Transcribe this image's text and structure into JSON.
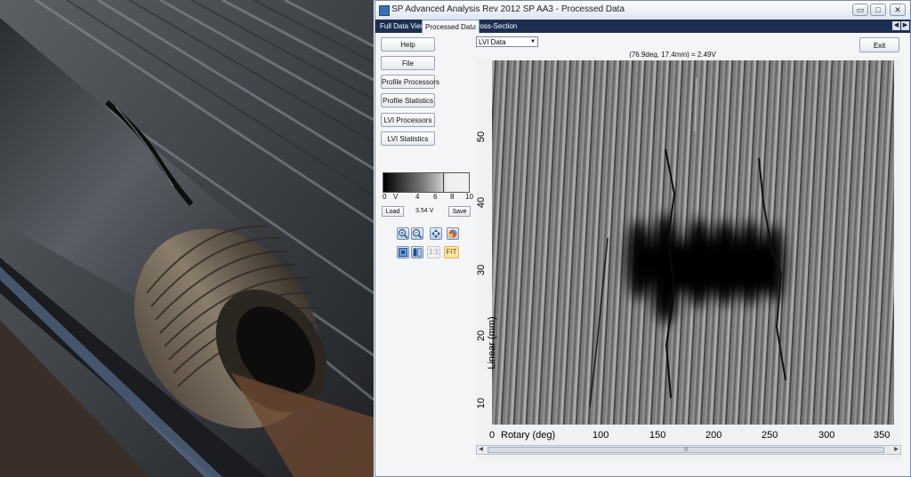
{
  "window": {
    "title": "SP Advanced Analysis Rev 2012 SP AA3 - Processed Data",
    "controls": {
      "minimize": "▭",
      "maximize": "□",
      "close": "✕"
    }
  },
  "tabs": [
    "Full Data View",
    "Processed Data",
    "Cross-Section"
  ],
  "tab_nav": {
    "left": "◀",
    "right": "▶"
  },
  "sidebar": {
    "buttons": [
      "Help",
      "File",
      "Profile Processors",
      "Profile Statistics",
      "LVI Processors",
      "LVI Statistics"
    ]
  },
  "dataset_select": {
    "value": "LVI Data",
    "arrow": "▼"
  },
  "exit_label": "Exit",
  "cursor_readout": "(76.9deg, 17.4mm) = 2.49V",
  "colorbar": {
    "ticks": [
      "0",
      "V",
      "4",
      "6",
      "8",
      "10"
    ],
    "value": "3.54 V",
    "load_label": "Load",
    "save_label": "Save",
    "marker_fraction": 0.7
  },
  "toolbar": {
    "zoom_in_icon": "zoom-in-icon",
    "zoom_out_icon": "zoom-out-icon",
    "ratio_label": "1:1",
    "fit_label": "FIT"
  },
  "plot": {
    "ylabel": "Linear (mm)",
    "yticks": [
      "10",
      "20",
      "30",
      "40",
      "50"
    ],
    "xlabel": "Rotary (deg)",
    "xticks": [
      "0",
      "100",
      "150",
      "200",
      "250",
      "300",
      "350"
    ]
  },
  "scrollbar": {
    "left": "◀",
    "right": "▶",
    "grip": "|||"
  },
  "colors": {
    "tabbar": "#1c2f52",
    "window_border": "#7a8aa6",
    "fit_button": "#fde7a5"
  }
}
